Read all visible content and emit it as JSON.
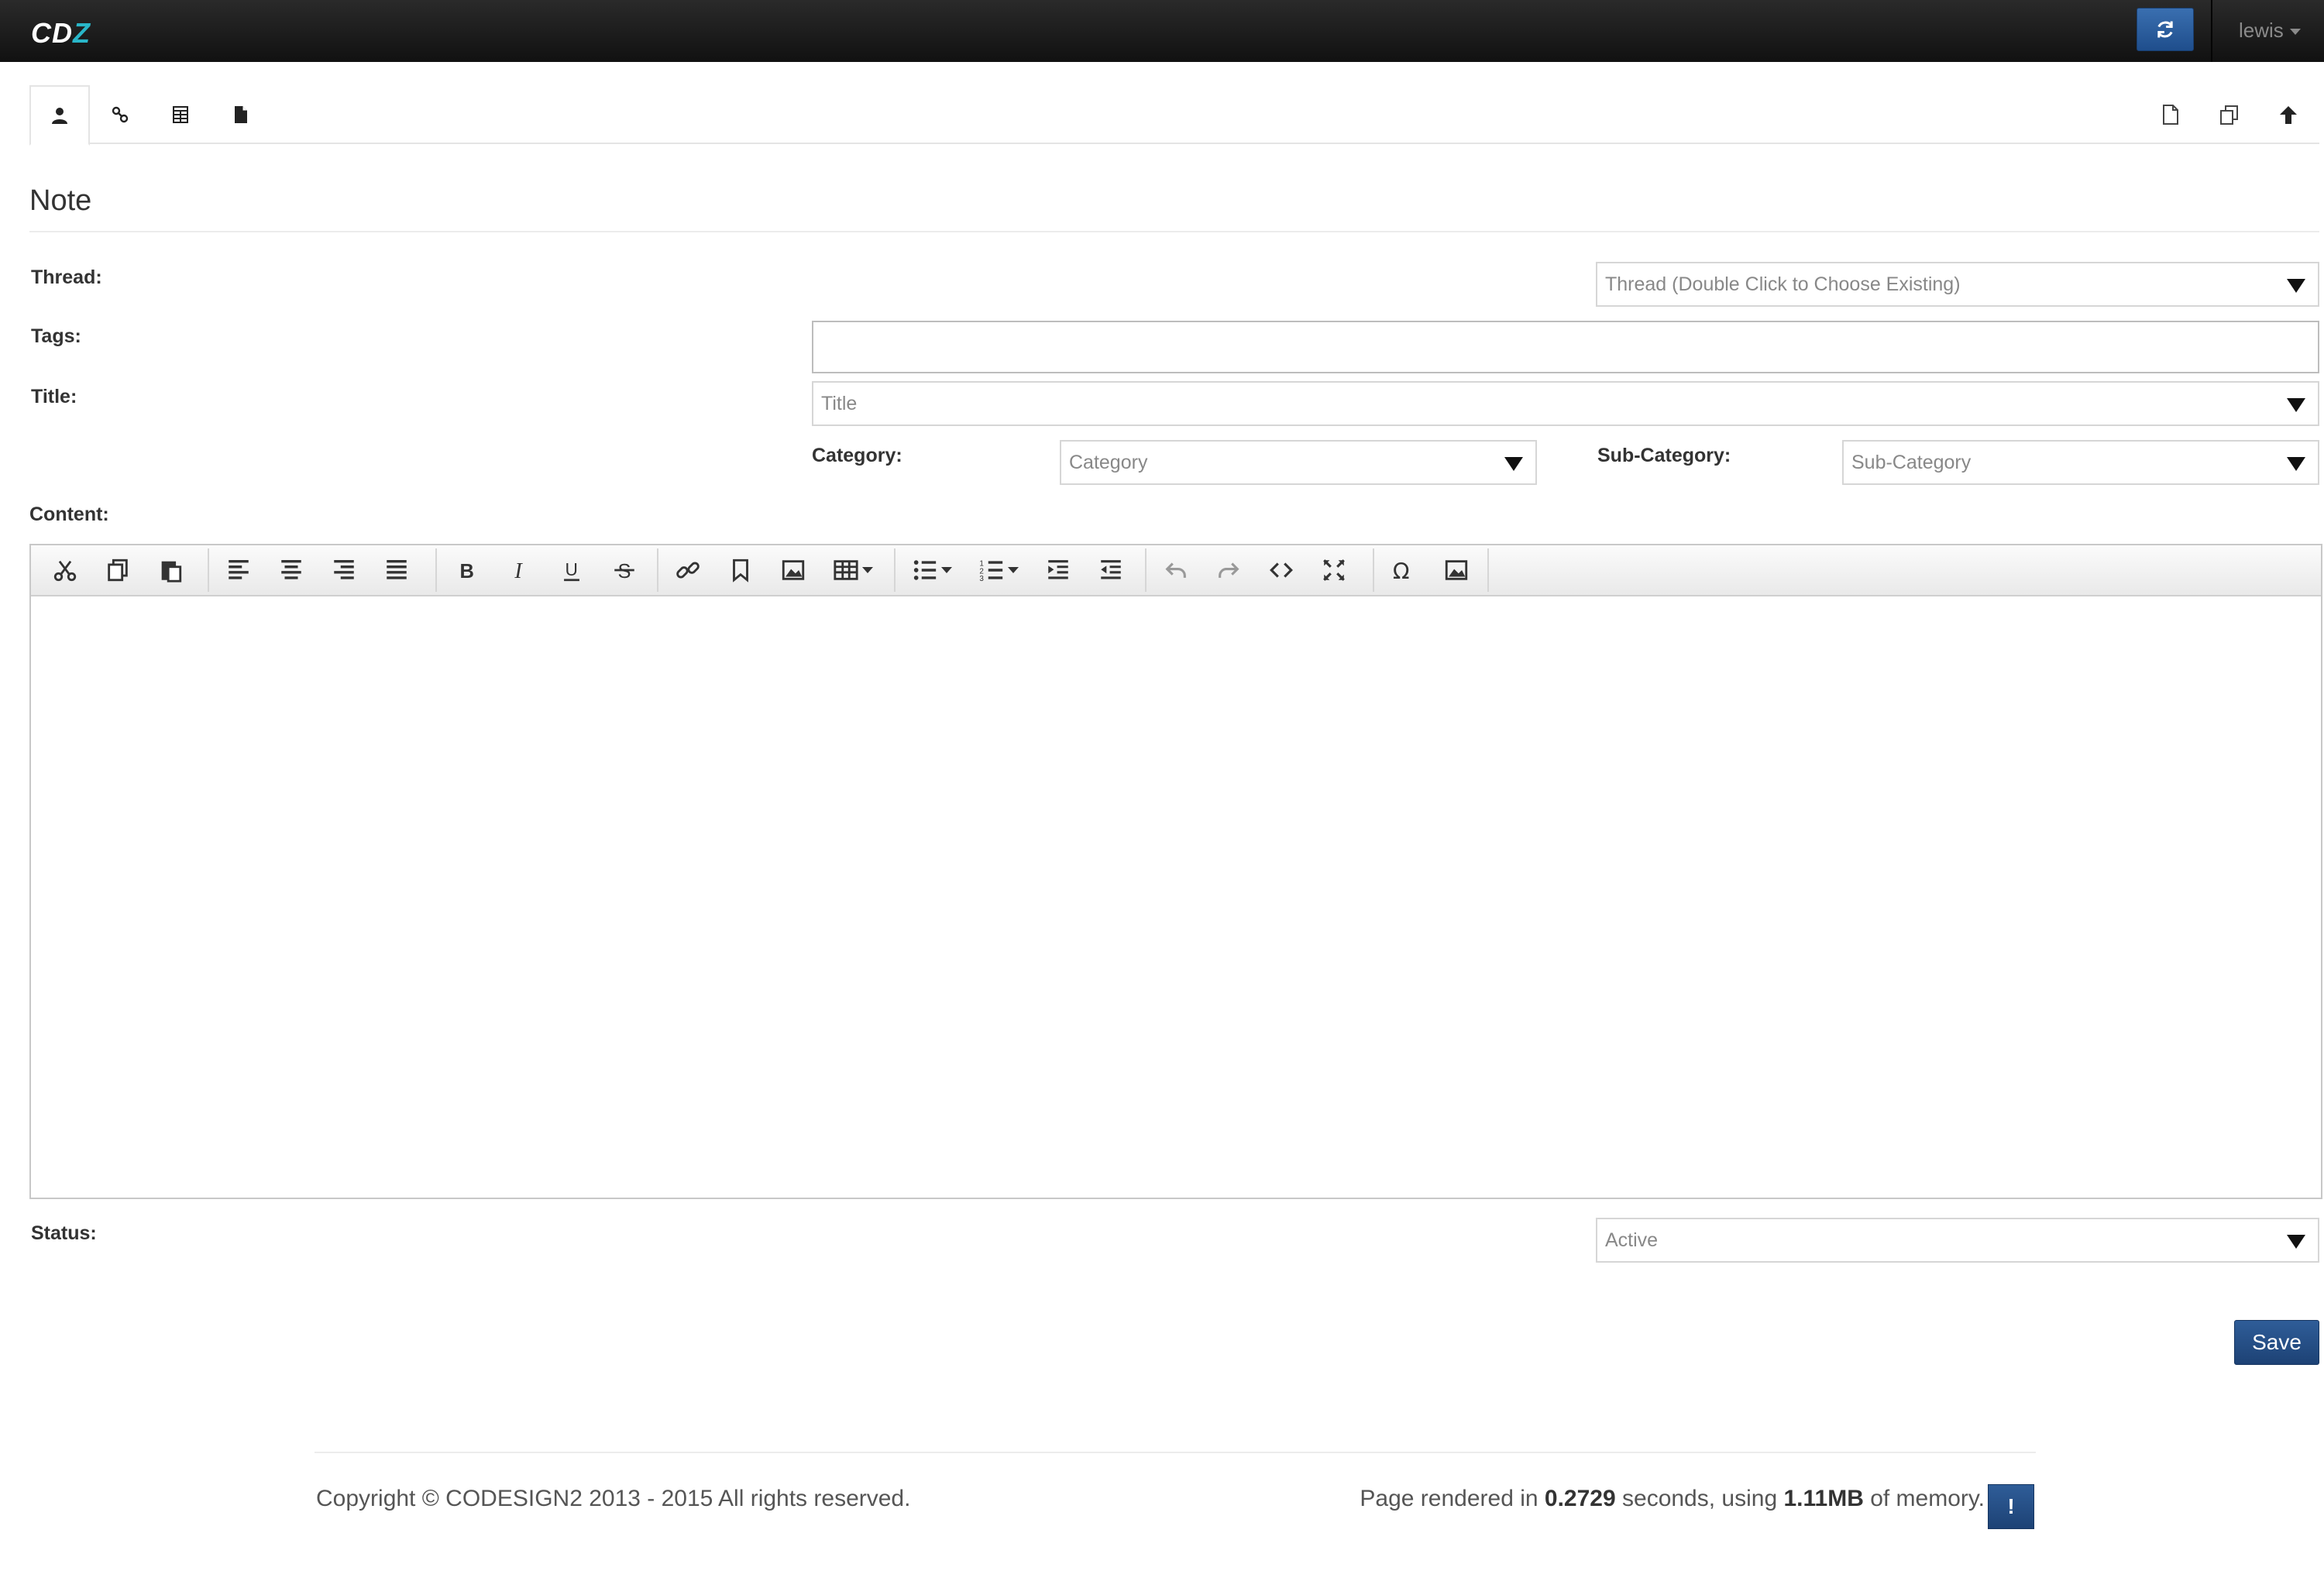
{
  "app": {
    "logo_main": "CD",
    "logo_accent": "Z",
    "user": "lewis"
  },
  "icons": {
    "refresh": "refresh-icon",
    "tabs": [
      "user-icon",
      "link-icon",
      "table-icon",
      "file-icon"
    ],
    "actions": [
      "new-document-icon",
      "copy-icon",
      "arrow-up-icon"
    ]
  },
  "page": {
    "title": "Note"
  },
  "form": {
    "thread_label": "Thread:",
    "thread_placeholder": "Thread (Double Click to Choose Existing)",
    "tags_label": "Tags:",
    "tags_value": "",
    "title_label": "Title:",
    "title_placeholder": "Title",
    "category_label": "Category:",
    "category_placeholder": "Category",
    "subcategory_label": "Sub-Category:",
    "subcategory_placeholder": "Sub-Category",
    "content_label": "Content:",
    "status_label": "Status:",
    "status_value": "Active",
    "save_label": "Save"
  },
  "editor": {
    "toolbar": [
      "cut",
      "copy",
      "paste",
      "align-left",
      "align-center",
      "align-right",
      "align-justify",
      "bold",
      "italic",
      "underline",
      "strikethrough",
      "link",
      "bookmark",
      "image",
      "table",
      "bullet-list",
      "numbered-list",
      "indent",
      "outdent",
      "undo",
      "redo",
      "source-code",
      "fullscreen",
      "special-character",
      "media"
    ]
  },
  "footer": {
    "copyright": "Copyright © CODESIGN2 2013 - 2015 All rights reserved.",
    "render_prefix": "Page rendered in ",
    "render_time": "0.2729",
    "render_mid": " seconds, using ",
    "render_memory": "1.11MB",
    "render_suffix": " of memory.",
    "info_label": "!"
  }
}
